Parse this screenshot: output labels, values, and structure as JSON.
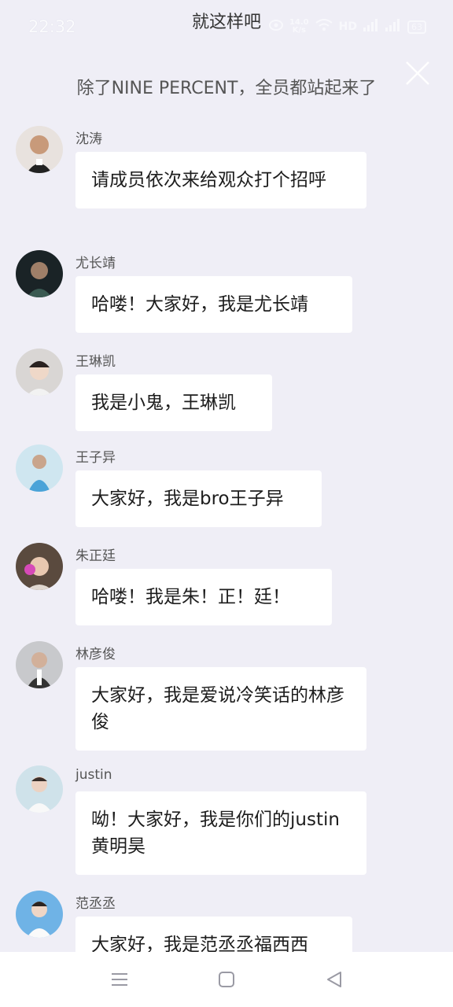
{
  "status": {
    "time": "22:32",
    "speed_value": "14.0",
    "speed_unit": "K/s",
    "network": "HD",
    "battery": "63"
  },
  "header": {
    "app_title": "就这样吧",
    "subtitle": "除了NINE PERCENT，全员都站起来了"
  },
  "messages": [
    {
      "name": "沈涛",
      "text": "请成员依次来给观众打个招呼"
    },
    {
      "name": "尤长靖",
      "text": "哈喽！大家好，我是尤长靖"
    },
    {
      "name": "王琳凯",
      "text": "我是小鬼，王琳凯"
    },
    {
      "name": "王子异",
      "text": "大家好，我是bro王子异"
    },
    {
      "name": "朱正廷",
      "text": "哈喽！我是朱！正！廷！"
    },
    {
      "name": "林彦俊",
      "text": "大家好，我是爱说冷笑话的林彦俊"
    },
    {
      "name": "justin",
      "text": "呦！大家好，我是你们的justin黄明昊"
    },
    {
      "name": "范丞丞",
      "text": "大家好，我是范丞丞福西西"
    }
  ],
  "icons": {
    "close": "close-icon",
    "nav_menu": "menu-icon",
    "nav_home": "home-icon",
    "nav_back": "back-icon"
  },
  "colors": {
    "background": "#efeef6",
    "bubble": "#ffffff"
  }
}
